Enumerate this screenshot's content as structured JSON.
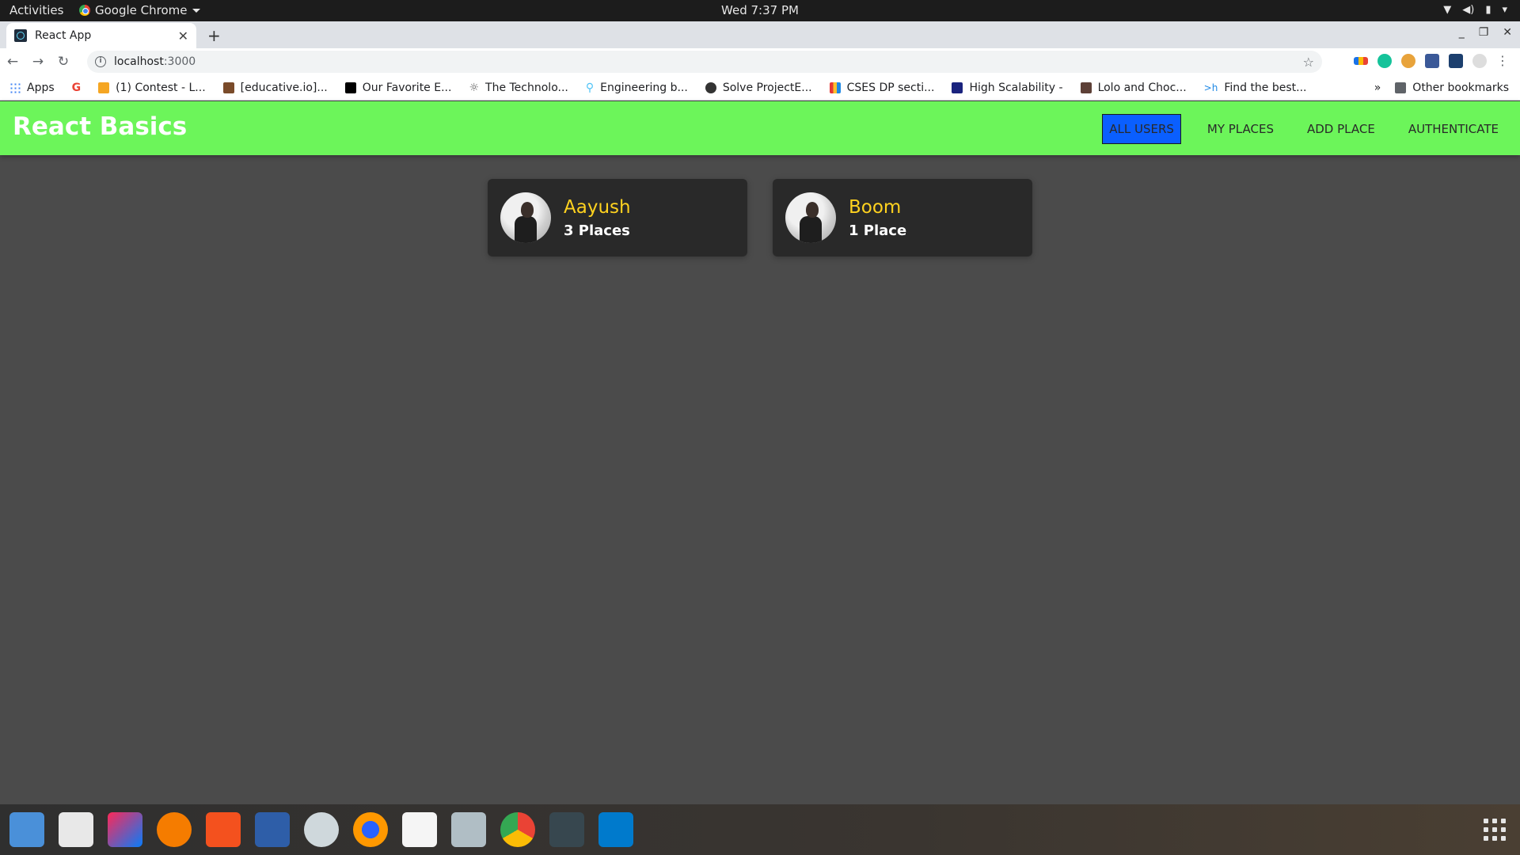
{
  "system": {
    "activities_label": "Activities",
    "app_menu_label": "Google Chrome",
    "clock": "Wed  7:37 PM"
  },
  "browser": {
    "tab_title": "React App",
    "url_host": "localhost",
    "url_port": ":3000",
    "bookmarks": [
      {
        "label": "Apps",
        "color": "#4285f4"
      },
      {
        "label": "(1) Contest - L...",
        "color": "#f5a623"
      },
      {
        "label": "[educative.io]...",
        "color": "#7a4b2a"
      },
      {
        "label": "Our Favorite E...",
        "color": "#000000"
      },
      {
        "label": "The Technolo...",
        "color": "#555555"
      },
      {
        "label": "Engineering b...",
        "color": "#4fc3f7"
      },
      {
        "label": "Solve ProjectE...",
        "color": "#333333"
      },
      {
        "label": "CSES DP secti...",
        "color": "#e53935"
      },
      {
        "label": "High Scalability -",
        "color": "#1a237e"
      },
      {
        "label": "Lolo and Choc...",
        "color": "#5d4037"
      },
      {
        "label": "Find the best...",
        "color": "#1e88e5"
      }
    ],
    "other_bookmarks": "Other bookmarks"
  },
  "app": {
    "title": "React Basics",
    "nav": {
      "all_users": "ALL USERS",
      "my_places": "MY PLACES",
      "add_place": "ADD PLACE",
      "authenticate": "AUTHENTICATE"
    },
    "users": [
      {
        "name": "Aayush",
        "places": "3 Places"
      },
      {
        "name": "Boom",
        "places": "1 Place"
      }
    ]
  },
  "colors": {
    "header_bg": "#6cf55a",
    "active_nav": "#0a5fff",
    "card_bg": "#292929",
    "name_color": "#ffd21f",
    "page_bg": "#4b4b4b"
  }
}
